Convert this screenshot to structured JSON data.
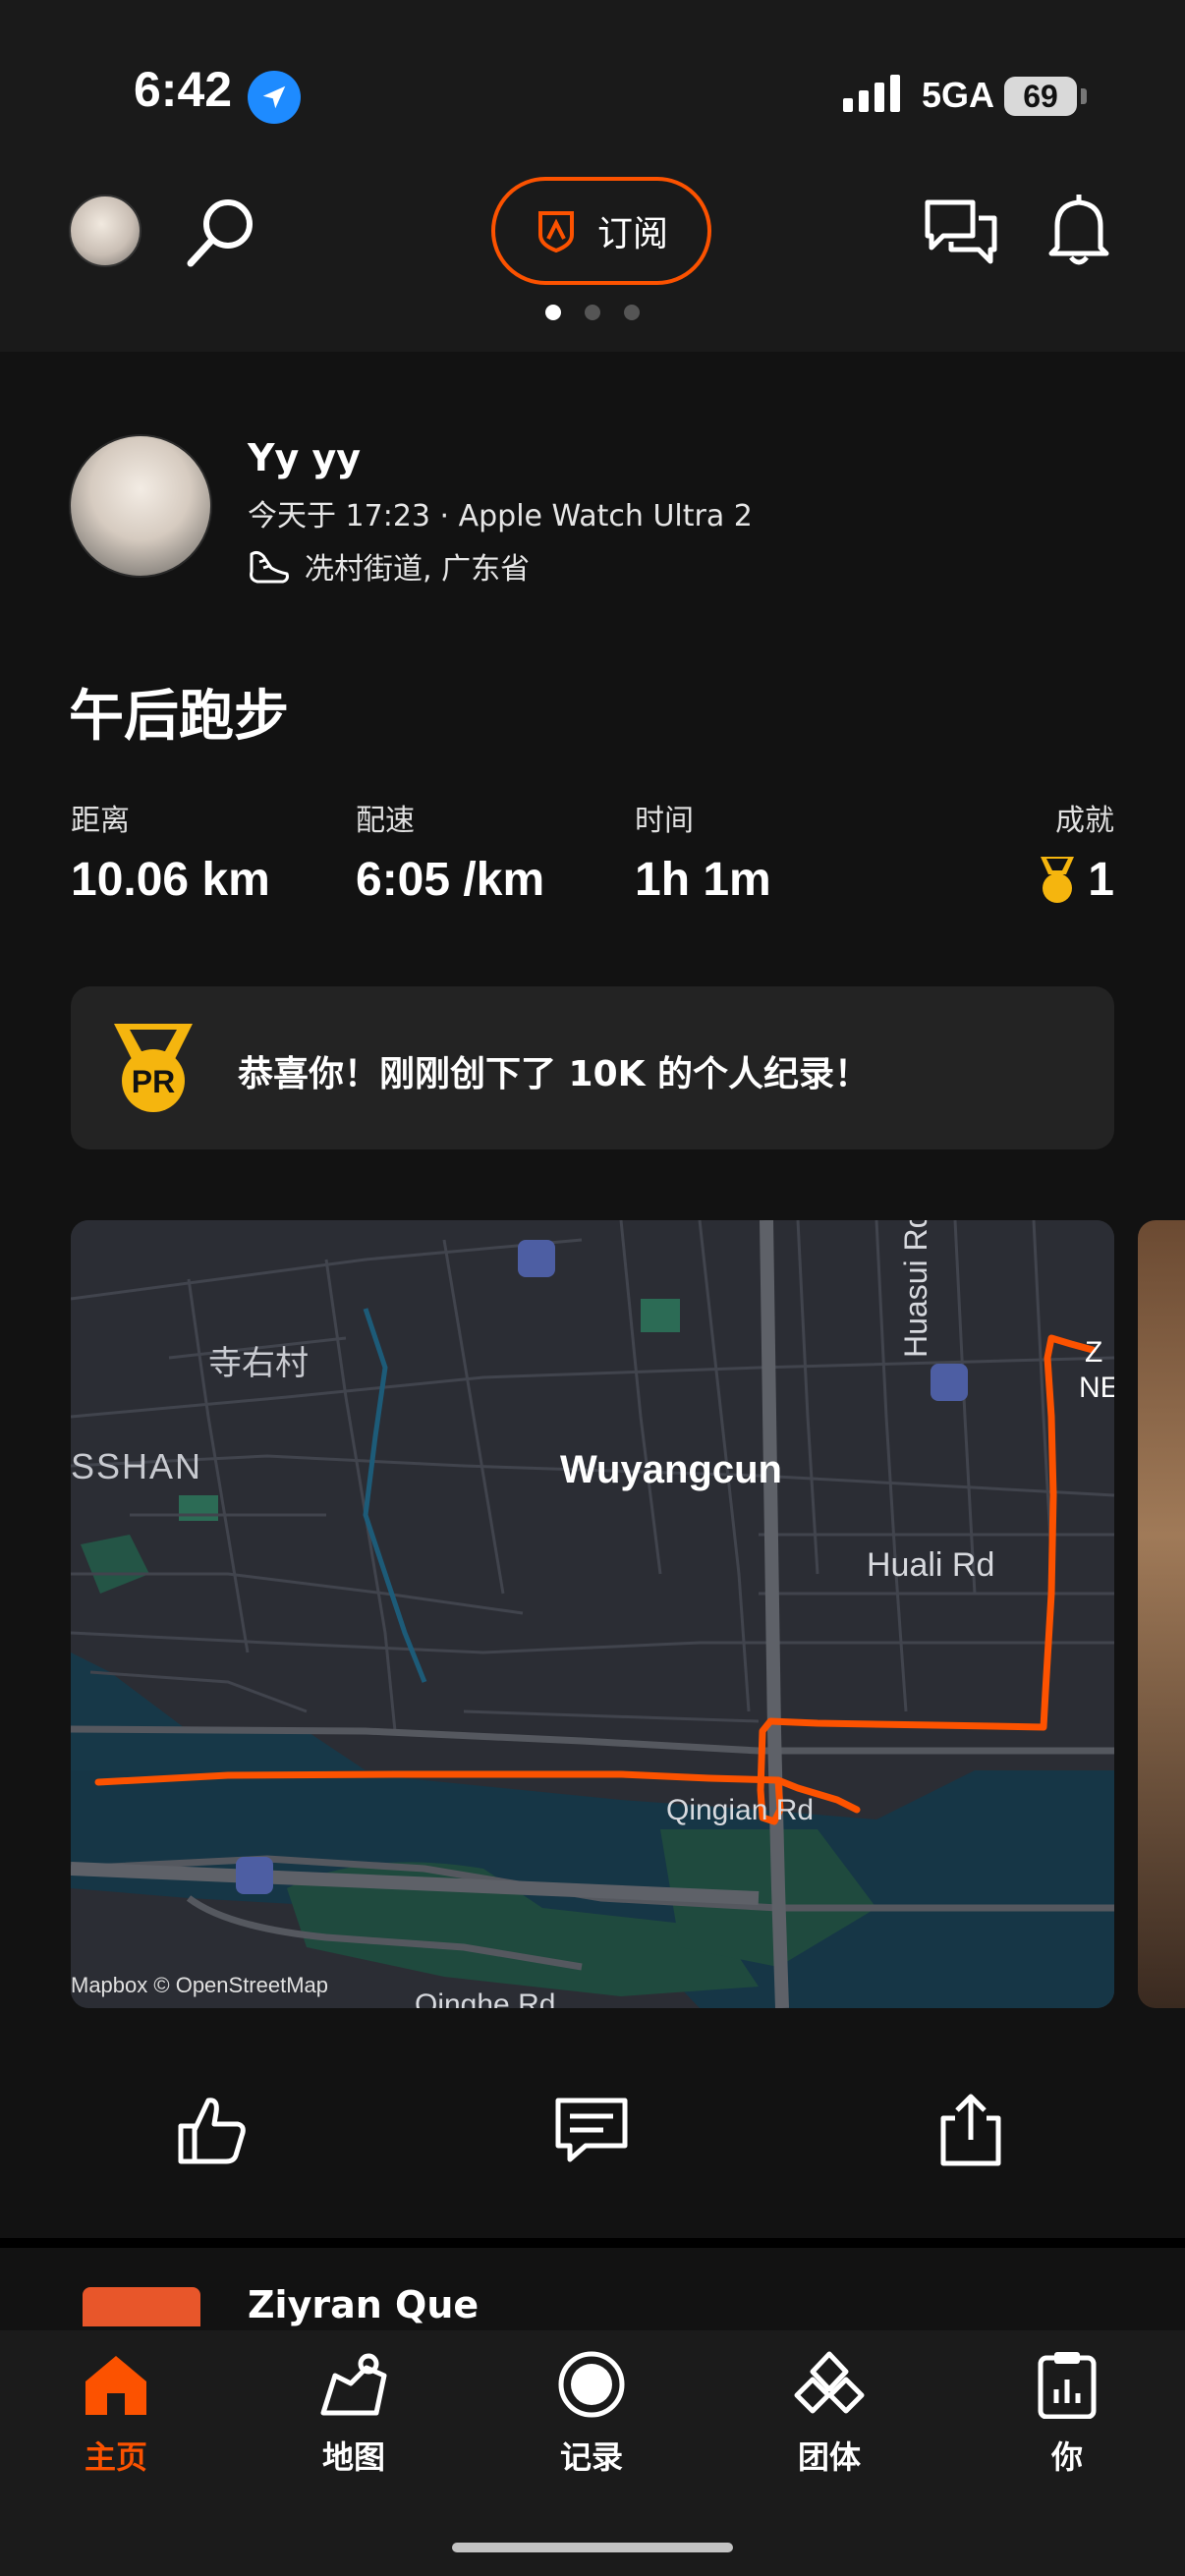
{
  "status_bar": {
    "time": "6:42",
    "network": "5GA",
    "battery": "69"
  },
  "topnav": {
    "subscribe_label": "订阅"
  },
  "pager": {
    "active": 1,
    "count": 3
  },
  "activity": {
    "author": "Yy yy",
    "meta": "今天于 17:23 · Apple Watch Ultra 2",
    "location": "冼村街道, 广东省",
    "title": "午后跑步",
    "stats": [
      {
        "label": "距离",
        "value": "10.06 km"
      },
      {
        "label": "配速",
        "value": "6:05 /km"
      },
      {
        "label": "时间",
        "value": "1h 1m"
      }
    ],
    "achievements": {
      "label": "成就",
      "value": "1"
    },
    "pr_message": "恭喜你！刚刚创下了 10K 的个人纪录！",
    "pr_badge": "PR"
  },
  "map": {
    "labels": {
      "village": "寺右村",
      "district": "SSHAN",
      "area": "Wuyangcun",
      "road1": "Huali Rd",
      "road2": "Huasui Rd",
      "road3": "Qingian Rd",
      "road4": "Qinghe Rd",
      "edge1": "Z",
      "edge2": "NE"
    },
    "attribution": "Mapbox © OpenStreetMap",
    "route_color": "#fc5200"
  },
  "next_activity": {
    "author": "Ziyran Que"
  },
  "tabbar": {
    "items": [
      {
        "label": "主页",
        "active": true
      },
      {
        "label": "地图"
      },
      {
        "label": "记录"
      },
      {
        "label": "团体"
      },
      {
        "label": "你"
      }
    ]
  },
  "colors": {
    "accent": "#fc5200",
    "gold": "#f5b50e",
    "background": "#121212"
  }
}
